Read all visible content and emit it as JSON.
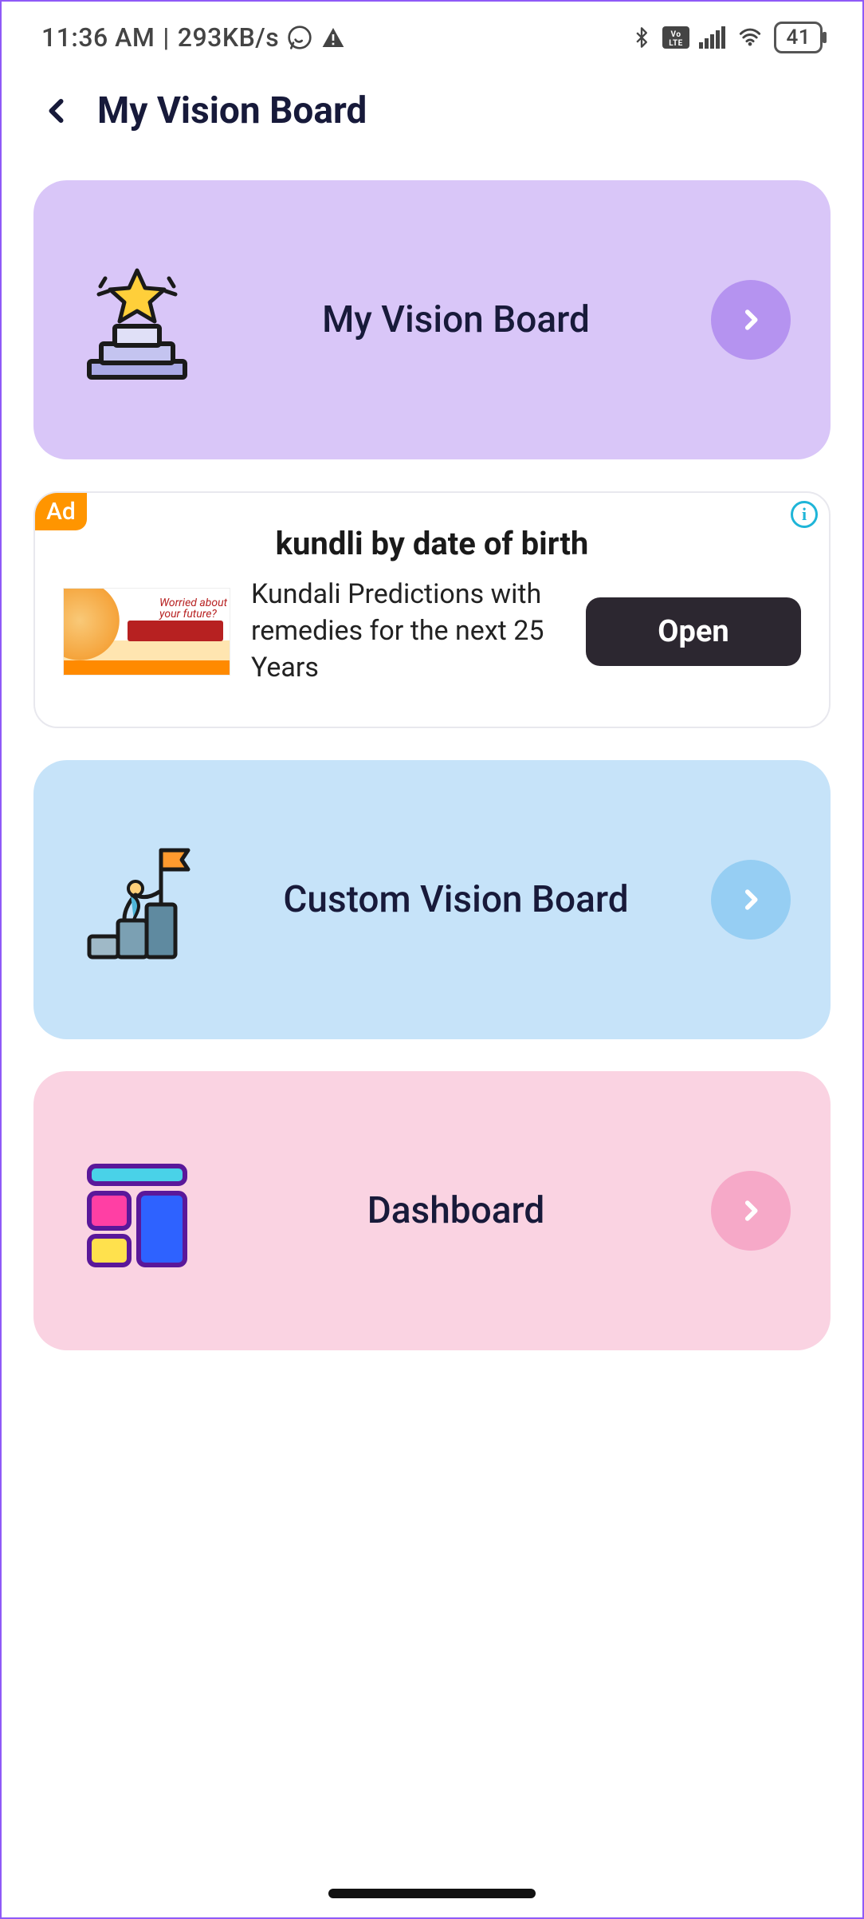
{
  "status": {
    "time": "11:36 AM",
    "speed": "293KB/s",
    "battery": "41"
  },
  "header": {
    "title": "My Vision Board"
  },
  "cards": {
    "vision": "My Vision Board",
    "custom": "Custom Vision Board",
    "dashboard": "Dashboard"
  },
  "ad": {
    "badge": "Ad",
    "title": "kundli by date of birth",
    "desc": "Kundali Predictions with remedies for the next 25 Years",
    "cta": "Open",
    "thumb_line1": "Worried about",
    "thumb_line2": "your future?"
  }
}
